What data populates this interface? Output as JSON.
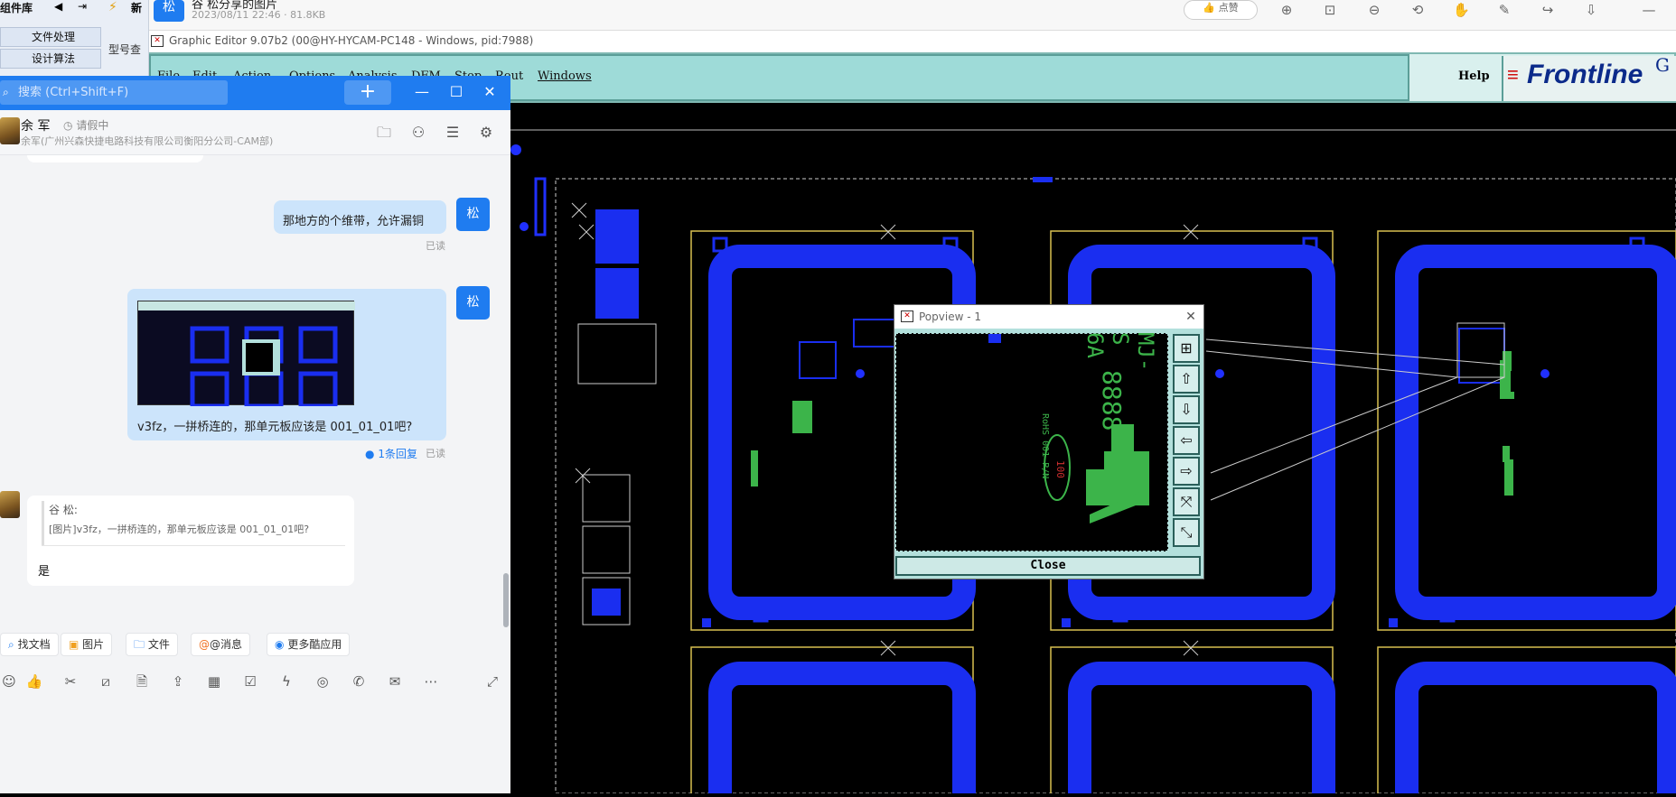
{
  "viewer": {
    "sender_initial": "松",
    "title": "谷 松分享的图片",
    "meta": "2023/08/11 22:46 · 81.8KB",
    "like_label": "点赞",
    "icons": [
      "zoom-in-icon",
      "actual-size-icon",
      "zoom-out-icon",
      "rotate-icon",
      "hand-icon",
      "edit-icon",
      "share-icon",
      "download-icon",
      "minimize-icon"
    ]
  },
  "left_strip": {
    "title": "组件库",
    "items": [
      "文件处理",
      "设计算法"
    ],
    "side_label_1": "新",
    "side_label_2": "型号查"
  },
  "editor": {
    "title": "Graphic Editor 9.07b2 (00@HY-HYCAM-PC148 - Windows, pid:7988)",
    "menus": [
      "File",
      "Edit",
      "Action",
      "Options",
      "Analysis",
      "DFM",
      "Step",
      "Rout",
      "Windows"
    ],
    "help": "Help",
    "logo": "Frontline",
    "logo_trail": "G"
  },
  "chat": {
    "search_placeholder": "搜索 (Ctrl+Shift+F)",
    "plus": "+",
    "contact": {
      "name": "余 军",
      "status": "请假中",
      "org": "余军(广州兴森快捷电路科技有限公司衡阳分公司-CAM部)"
    },
    "messages": [
      {
        "from": "me",
        "avatar": "松",
        "text": "那地方的个维带，允许漏铜",
        "read": "已读"
      },
      {
        "from": "me",
        "avatar": "松",
        "text": "v3fz，一拼桥连的，那单元板应该是   001_01_01吧?",
        "read": "已读",
        "replies": "1条回复"
      }
    ],
    "quote": {
      "name": "谷 松:",
      "text": "[图片]v3fz，一拼桥连的，那单元板应该是   001_01_01吧?",
      "reply": "是"
    },
    "chips": [
      "找文档",
      "图片",
      "文件",
      "@消息",
      "更多酷应用"
    ],
    "tools": [
      "thumb-icon",
      "scissors-icon",
      "slash-icon",
      "doc-add-icon",
      "upload-icon",
      "calendar-icon",
      "task-icon",
      "flash-icon",
      "headset-icon",
      "phone-icon",
      "mail-icon",
      "more-icon"
    ]
  },
  "popview": {
    "title": "Popview - 1",
    "close_label": "Close",
    "view_text_1": "MJ-S 6A",
    "view_text_2": "8888",
    "view_text_3": "RoHS 001 P/N",
    "view_text_4": "100"
  }
}
